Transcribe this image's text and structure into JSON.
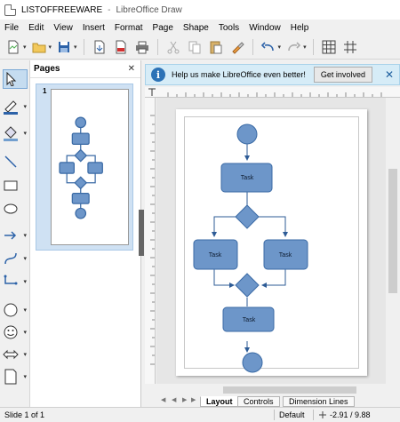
{
  "window": {
    "doc_title": "LISTOFFREEWARE",
    "separator": "-",
    "app_name": "LibreOffice Draw"
  },
  "menu": [
    "File",
    "Edit",
    "View",
    "Insert",
    "Format",
    "Page",
    "Shape",
    "Tools",
    "Window",
    "Help"
  ],
  "sidebar": {
    "title": "Pages",
    "close": "✕",
    "page_number": "1"
  },
  "infobar": {
    "icon": "i",
    "message": "Help us make LibreOffice even better!",
    "button": "Get involved",
    "close": "✕"
  },
  "diagram": {
    "shapes": [
      {
        "kind": "start-circle"
      },
      {
        "kind": "task",
        "label": "Task"
      },
      {
        "kind": "decision"
      },
      {
        "kind": "task",
        "label": "Task"
      },
      {
        "kind": "task",
        "label": "Task"
      },
      {
        "kind": "decision"
      },
      {
        "kind": "task",
        "label": "Task"
      },
      {
        "kind": "end-circle"
      }
    ],
    "fill": "#6d96c9",
    "stroke": "#3a6aa5"
  },
  "tabs": [
    "Layout",
    "Controls",
    "Dimension Lines"
  ],
  "status": {
    "slide": "Slide 1 of 1",
    "style": "Default",
    "coords": "-2.91 / 9.88"
  },
  "icons": [
    "select-arrow-icon",
    "line-color-icon",
    "fill-color-icon",
    "line-icon",
    "rectangle-icon",
    "ellipse-icon",
    "arrow-line-icon",
    "curve-icon",
    "connector-icon",
    "circle-icon",
    "smiley-icon",
    "double-arrow-icon",
    "flowchart-icon"
  ]
}
